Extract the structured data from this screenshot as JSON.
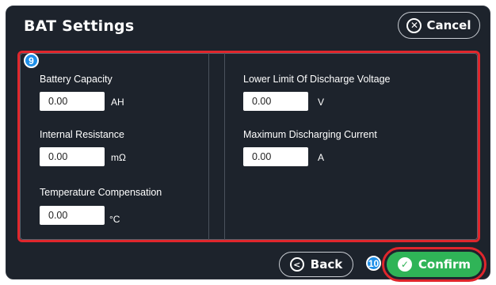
{
  "window": {
    "title": "BAT Settings"
  },
  "header": {
    "cancel_label": "Cancel",
    "cancel_icon": "close-circle-icon"
  },
  "annotations": {
    "settings_badge": "9",
    "confirm_badge": "10",
    "highlight_color": "#e0262c",
    "badge_color": "#1e8fe8"
  },
  "settings": {
    "battery_capacity": {
      "label": "Battery Capacity",
      "value": "0.00",
      "unit": "AH"
    },
    "internal_resistance": {
      "label": "Internal Resistance",
      "value": "0.00",
      "unit": "mΩ"
    },
    "temperature_compensation": {
      "label": "Temperature  Compensation",
      "value": "0.00",
      "unit": "°C"
    },
    "lower_limit_voltage": {
      "label": "Lower Limit Of Discharge Voltage",
      "value": "0.00",
      "unit": "V"
    },
    "max_discharging_current": {
      "label": "Maximum Discharging Current",
      "value": "0.00",
      "unit": "A"
    }
  },
  "footer": {
    "back_label": "Back",
    "confirm_label": "Confirm",
    "confirm_color": "#2fb457"
  }
}
